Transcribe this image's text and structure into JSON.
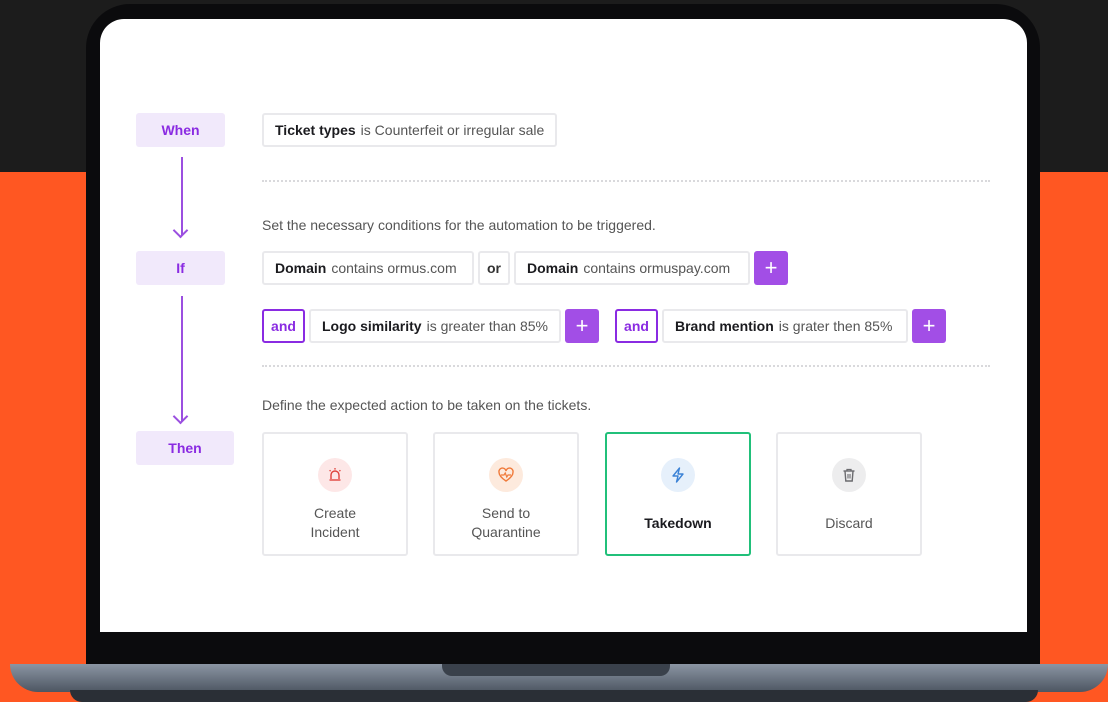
{
  "colors": {
    "accent": "#8a2be2",
    "background_top": "#1c1c1c",
    "background_bottom": "#ff5722",
    "selected_border": "#21c07a"
  },
  "workflow": {
    "when_label": "When",
    "if_label": "If",
    "then_label": "Then"
  },
  "trigger": {
    "field": "Ticket types",
    "condition": "is Counterfeit or irregular sale"
  },
  "conditions": {
    "hint": "Set the necessary conditions for the automation to be triggered.",
    "row1": {
      "c1_field": "Domain",
      "c1_condition": "contains ormus.com",
      "operator": "or",
      "c2_field": "Domain",
      "c2_condition": "contains ormuspay.com",
      "add": "+"
    },
    "row2": {
      "and_label": "and",
      "c1_field": "Logo similarity",
      "c1_condition": "is greater than 85%",
      "add": "+",
      "and2_label": "and",
      "c2_field": "Brand mention",
      "c2_condition": "is grater then 85%",
      "add2": "+"
    }
  },
  "actions": {
    "hint": "Define the expected action to be taken on the tickets.",
    "items": [
      {
        "label": "Create\nIncident",
        "icon": "siren-icon"
      },
      {
        "label": "Send to\nQuarantine",
        "icon": "heart-pulse-icon"
      },
      {
        "label": "Takedown",
        "icon": "lightning-icon",
        "selected": true
      },
      {
        "label": "Discard",
        "icon": "trash-icon"
      }
    ]
  }
}
